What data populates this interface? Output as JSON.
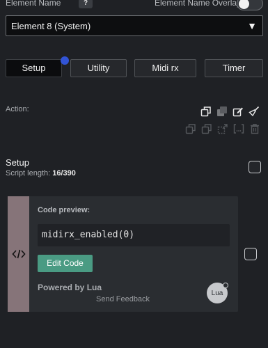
{
  "header": {
    "element_name_label": "Element Name",
    "help_label": "?",
    "overlay_label": "Element Name Overlay",
    "overlay_enabled": false
  },
  "element_select": {
    "value": "Element 8 (System)",
    "arrow": "▼"
  },
  "tabs": [
    {
      "label": "Setup",
      "active": true,
      "has_indicator": true
    },
    {
      "label": "Utility",
      "active": false
    },
    {
      "label": "Midi rx",
      "active": false
    },
    {
      "label": "Timer",
      "active": false
    }
  ],
  "actions": {
    "label": "Action:",
    "primary_icons": [
      "copy-icon",
      "duplicate-icon",
      "edit-icon",
      "clear-icon"
    ],
    "secondary_icons": [
      "copy-icon",
      "duplicate-icon",
      "paste-icon",
      "bracket-icon",
      "delete-icon"
    ]
  },
  "setup": {
    "title": "Setup",
    "script_length_label": "Script length:",
    "script_length_value": "16/390"
  },
  "code_block": {
    "preview_label": "Code preview:",
    "code": "midirx_enabled(0)",
    "edit_button": "Edit Code",
    "powered_by": "Powered by Lua",
    "feedback": "Send Feedback",
    "lua_logo_text": "Lua"
  },
  "colors": {
    "background": "#1f2125",
    "accent_blue": "#3254d6",
    "edit_button": "#4a9b83",
    "block_handle": "#867479"
  }
}
